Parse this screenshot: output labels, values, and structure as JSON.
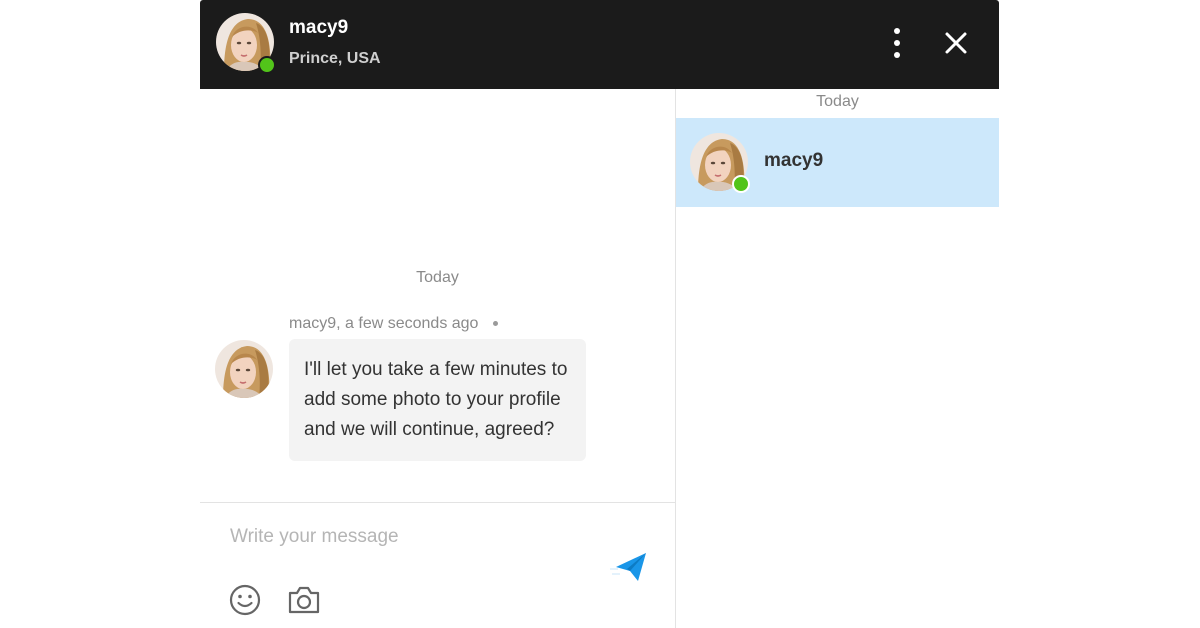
{
  "header": {
    "user_name": "macy9",
    "location": "Prince, USA"
  },
  "chat": {
    "date_separator": "Today",
    "messages": [
      {
        "author": "macy9,",
        "time": "a few seconds ago",
        "text": "I'll let you take a few minutes to add some photo to your profile and we will continue, agreed?"
      }
    ],
    "composer": {
      "placeholder": "Write your message"
    }
  },
  "sidebar": {
    "date_separator": "Today",
    "conversations": [
      {
        "name": "macy9",
        "online": true,
        "selected": true
      }
    ]
  },
  "colors": {
    "header_bg": "#1b1b1b",
    "selected_conversation_bg": "#cde8fb",
    "online": "#52c41a",
    "send_icon": "#1a96e8",
    "bubble_bg": "#f3f3f3"
  },
  "icons": [
    "more-vertical-icon",
    "close-icon",
    "send-icon",
    "emoji-icon",
    "camera-icon"
  ]
}
